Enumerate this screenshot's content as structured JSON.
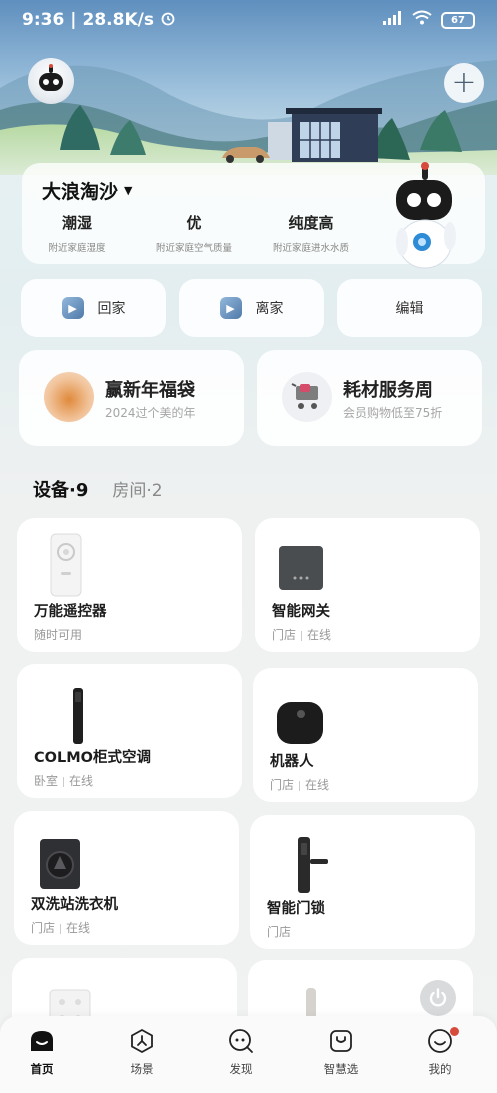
{
  "status_bar": {
    "time": "9:36",
    "speed": "28.8K/s",
    "battery": "67"
  },
  "home": {
    "name": "大浪淘沙",
    "stats": [
      {
        "value": "潮湿",
        "label": "附近家庭湿度"
      },
      {
        "value": "优",
        "label": "附近家庭空气质量"
      },
      {
        "value": "纯度高",
        "label": "附近家庭进水水质"
      }
    ]
  },
  "quick_actions": {
    "home": "回家",
    "away": "离家",
    "edit": "编辑"
  },
  "promos": [
    {
      "title": "赢新年福袋",
      "subtitle": "2024过个美的年"
    },
    {
      "title": "耗材服务周",
      "subtitle": "会员购物低至75折"
    }
  ],
  "tabs": {
    "devices": "设备·9",
    "rooms": "房间·2"
  },
  "devices": [
    {
      "name": "万能遥控器",
      "room": "随时可用",
      "status": ""
    },
    {
      "name": "智能网关",
      "room": "门店",
      "status": "在线"
    },
    {
      "name": "COLMO柜式空调",
      "room": "卧室",
      "status": "在线"
    },
    {
      "name": "机器人",
      "room": "门店",
      "status": "在线"
    },
    {
      "name": "双洗站洗衣机",
      "room": "门店",
      "status": "在线"
    },
    {
      "name": "智能门锁",
      "room": "门店",
      "status": ""
    }
  ],
  "nav": [
    {
      "label": "首页",
      "icon": "home-icon"
    },
    {
      "label": "场景",
      "icon": "scene-icon"
    },
    {
      "label": "发现",
      "icon": "discover-icon"
    },
    {
      "label": "智慧选",
      "icon": "shop-icon"
    },
    {
      "label": "我的",
      "icon": "profile-icon"
    }
  ],
  "colors": {
    "accent": "#4f79a8",
    "notification_dot": "#d64b3c"
  }
}
